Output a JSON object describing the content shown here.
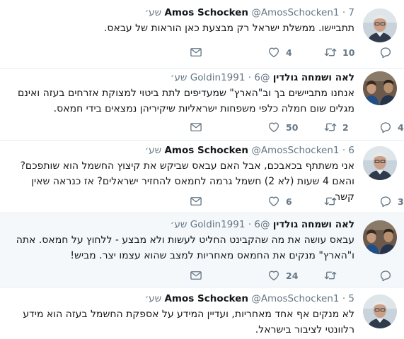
{
  "colors": {
    "text": "#14171a",
    "muted": "#657786",
    "divider": "#e6ecf0",
    "highlight": "#f5f8fa"
  },
  "icons": {
    "reply": "reply-icon",
    "retweet": "retweet-icon",
    "like": "heart-icon",
    "dm": "envelope-icon"
  },
  "tweets": [
    {
      "name": "Amos Schocken",
      "handle": "@AmosSchocken1",
      "time": "7 שע׳",
      "text": "תתביישו. ממשלת ישראל רק מבצעת כאן הוראות של עבאס.",
      "replies": "",
      "retweets": "10",
      "likes": "4",
      "avatar": "schocken"
    },
    {
      "name": "לאה ושמחה גולדין",
      "handle": "@Goldin1991",
      "time": "6 שע׳",
      "text": "אנחנו מתביישים בך וב\"הארץ\" שמעדיפים לתת ביטוי למצוקת אזרחים בעזה ואינם מגלים שום חמלה כלפי משפחות ישראליות שיקיריהן נמצאים בידי חמאס.",
      "replies": "4",
      "retweets": "2",
      "likes": "50",
      "avatar": "goldin"
    },
    {
      "name": "Amos Schocken",
      "handle": "@AmosSchocken1",
      "time": "6 שע׳",
      "text": "אני משתתף בכאבכם, אבל האם עבאס שביקש את קיצוץ החשמל הוא שותפכם? והאם 4 שעות (לא 2) חשמל גרמה לחמאס להחזיר ישראלים? אז כנראה שאין קשר.",
      "replies": "3",
      "retweets": "",
      "likes": "6",
      "avatar": "schocken"
    },
    {
      "name": "לאה ושמחה גולדין",
      "handle": "@Goldin1991",
      "time": "6 שע׳",
      "text": "עבאס עושה את מה שהקבינט החליט לעשות ולא מבצע - ללחוץ על חמאס. אתה ו\"הארץ\" מנקים את החמאס מאחריות למצב שהוא עצמו יצר. מביש!",
      "replies": "",
      "retweets": "",
      "likes": "24",
      "avatar": "goldin"
    },
    {
      "name": "Amos Schocken",
      "handle": "@AmosSchocken1",
      "time": "5 שע׳",
      "text": "לא מנקים אף אחד מאחריות, ועדיין המידע על אספקת החשמל בעזה הוא מידע רלוונטי לציבור בישראל.",
      "replies": "",
      "retweets": "",
      "likes": "",
      "avatar": "schocken"
    }
  ]
}
